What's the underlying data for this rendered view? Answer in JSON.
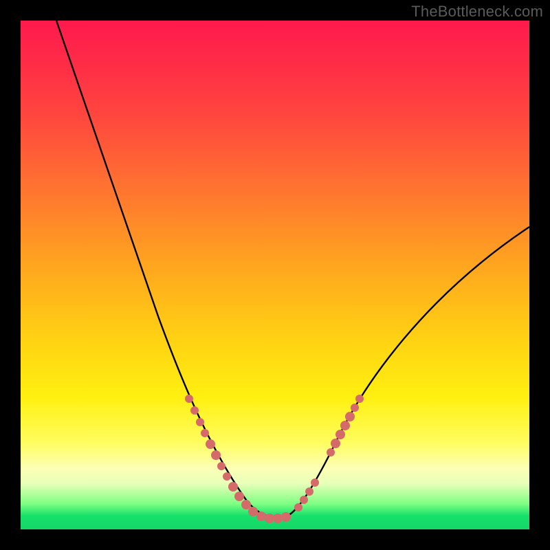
{
  "watermark": "TheBottleneck.com",
  "chart_data": {
    "type": "line",
    "title": "",
    "xlabel": "",
    "ylabel": "",
    "xlim": [
      0,
      100
    ],
    "ylim": [
      0,
      100
    ],
    "series": [
      {
        "name": "bottleneck-curve",
        "x": [
          7,
          10,
          14,
          18,
          22,
          26,
          30,
          33,
          36,
          39,
          41,
          43,
          45,
          47,
          49,
          51,
          53,
          55,
          59,
          63,
          68,
          74,
          81,
          89,
          98
        ],
        "y": [
          100,
          92,
          82,
          72,
          62,
          52,
          43,
          35,
          28,
          21,
          15,
          10,
          6,
          3,
          2,
          2,
          3,
          5,
          10,
          17,
          25,
          34,
          43,
          52,
          60
        ]
      }
    ],
    "markers": {
      "name": "highlight-dots",
      "color": "#d86a6a",
      "left_cluster": {
        "x": [
          33,
          35,
          37,
          38,
          40,
          41,
          43,
          44,
          46,
          47,
          48
        ],
        "y": [
          35,
          31,
          26,
          23,
          18,
          15,
          10,
          8,
          5,
          3.5,
          3
        ]
      },
      "right_cluster": {
        "x": [
          53,
          54,
          55,
          56,
          60,
          61,
          62,
          63,
          64,
          65
        ],
        "y": [
          3,
          4,
          5,
          6,
          12,
          14,
          16,
          17,
          19,
          21
        ]
      }
    },
    "gradient_bands": [
      {
        "color": "#ff1a4d",
        "from_y": 100,
        "to_y": 80
      },
      {
        "color": "#ff8a2a",
        "from_y": 80,
        "to_y": 55
      },
      {
        "color": "#ffe312",
        "from_y": 55,
        "to_y": 20
      },
      {
        "color": "#fcffb5",
        "from_y": 20,
        "to_y": 8
      },
      {
        "color": "#17e06a",
        "from_y": 8,
        "to_y": 0
      }
    ]
  }
}
